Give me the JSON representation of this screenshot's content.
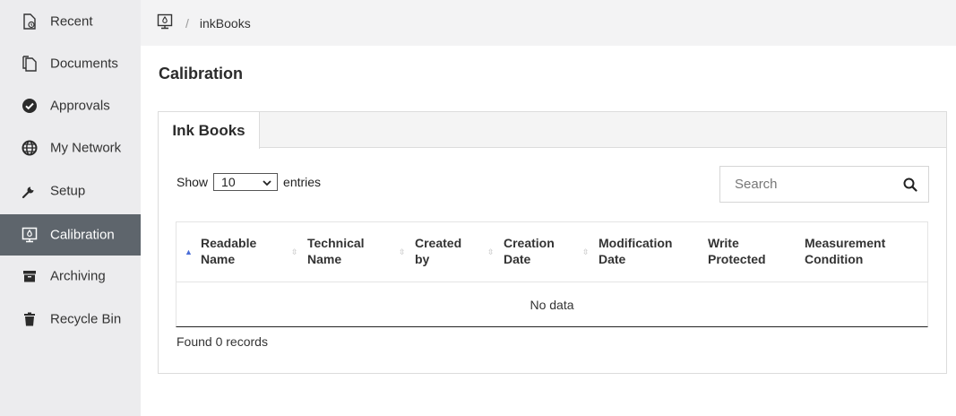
{
  "sidebar": {
    "items": [
      {
        "label": "Recent",
        "icon": "recent-doc-icon"
      },
      {
        "label": "Documents",
        "icon": "documents-icon"
      },
      {
        "label": "Approvals",
        "icon": "check-circle-icon"
      },
      {
        "label": "My Network",
        "icon": "globe-icon"
      },
      {
        "label": "Setup",
        "icon": "wrench-icon"
      },
      {
        "label": "Calibration",
        "icon": "calibration-icon",
        "active": true
      },
      {
        "label": "Archiving",
        "icon": "archive-box-icon"
      },
      {
        "label": "Recycle Bin",
        "icon": "trash-icon"
      }
    ]
  },
  "breadcrumb": {
    "separator": "/",
    "current": "inkBooks"
  },
  "page": {
    "title": "Calibration"
  },
  "panel": {
    "tab_label": "Ink Books",
    "length": {
      "prefix": "Show",
      "value": "10",
      "suffix": "entries"
    },
    "search": {
      "placeholder": "Search"
    },
    "table": {
      "columns": [
        {
          "label_line1": "Readable",
          "label_line2": "Name",
          "sort": "asc"
        },
        {
          "label_line1": "Technical",
          "label_line2": "Name",
          "sort": "both"
        },
        {
          "label_line1": "Created",
          "label_line2": "by",
          "sort": "both"
        },
        {
          "label_line1": "Creation",
          "label_line2": "Date",
          "sort": "both"
        },
        {
          "label_line1": "Modification",
          "label_line2": "Date",
          "sort": "both"
        },
        {
          "label_line1": "Write",
          "label_line2": "Protected",
          "sort": "none"
        },
        {
          "label_line1": "Measurement",
          "label_line2": "Condition",
          "sort": "none"
        }
      ],
      "empty_text": "No data"
    },
    "info": "Found 0 records"
  },
  "colors": {
    "sidebar_bg": "#ececee",
    "active_bg": "#5e656c",
    "sort_active": "#4a6dd8"
  }
}
